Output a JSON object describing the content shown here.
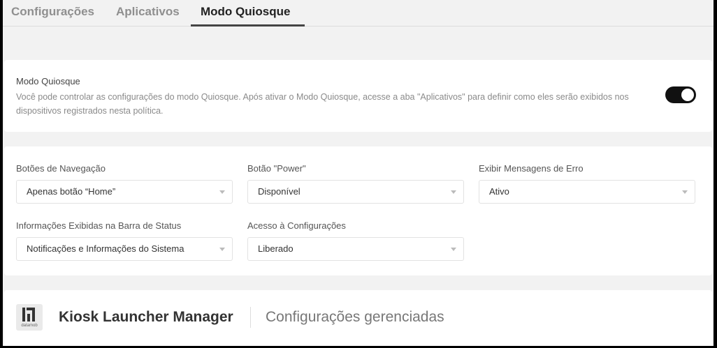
{
  "tabs": [
    {
      "label": "Configurações",
      "active": false
    },
    {
      "label": "Aplicativos",
      "active": false
    },
    {
      "label": "Modo Quiosque",
      "active": true
    }
  ],
  "kiosk": {
    "title": "Modo Quiosque",
    "description": "Você pode controlar as configurações do modo Quiosque. Após ativar o Modo Quiosque, acesse a aba \"Aplicativos\" para definir como eles serão exibidos nos dispositivos registrados nesta política.",
    "enabled": true
  },
  "fields": {
    "nav_buttons": {
      "label": "Botões de Navegação",
      "value": "Apenas botão “Home”"
    },
    "power_button": {
      "label": "Botão \"Power\"",
      "value": "Disponível"
    },
    "error_messages": {
      "label": "Exibir Mensagens de Erro",
      "value": "Ativo"
    },
    "status_bar": {
      "label": "Informações Exibidas na Barra de Status",
      "value": "Notificações e Informações do Sistema"
    },
    "settings_access": {
      "label": "Acesso à Configurações",
      "value": "Liberado"
    }
  },
  "footer": {
    "logo_text": "datamob",
    "app_name": "Kiosk Launcher Manager",
    "subtitle": "Configurações gerenciadas"
  },
  "icons": {
    "logo": "datamob-logo-icon",
    "toggle": "toggle-switch",
    "dropdown": "chevron-down-icon"
  }
}
